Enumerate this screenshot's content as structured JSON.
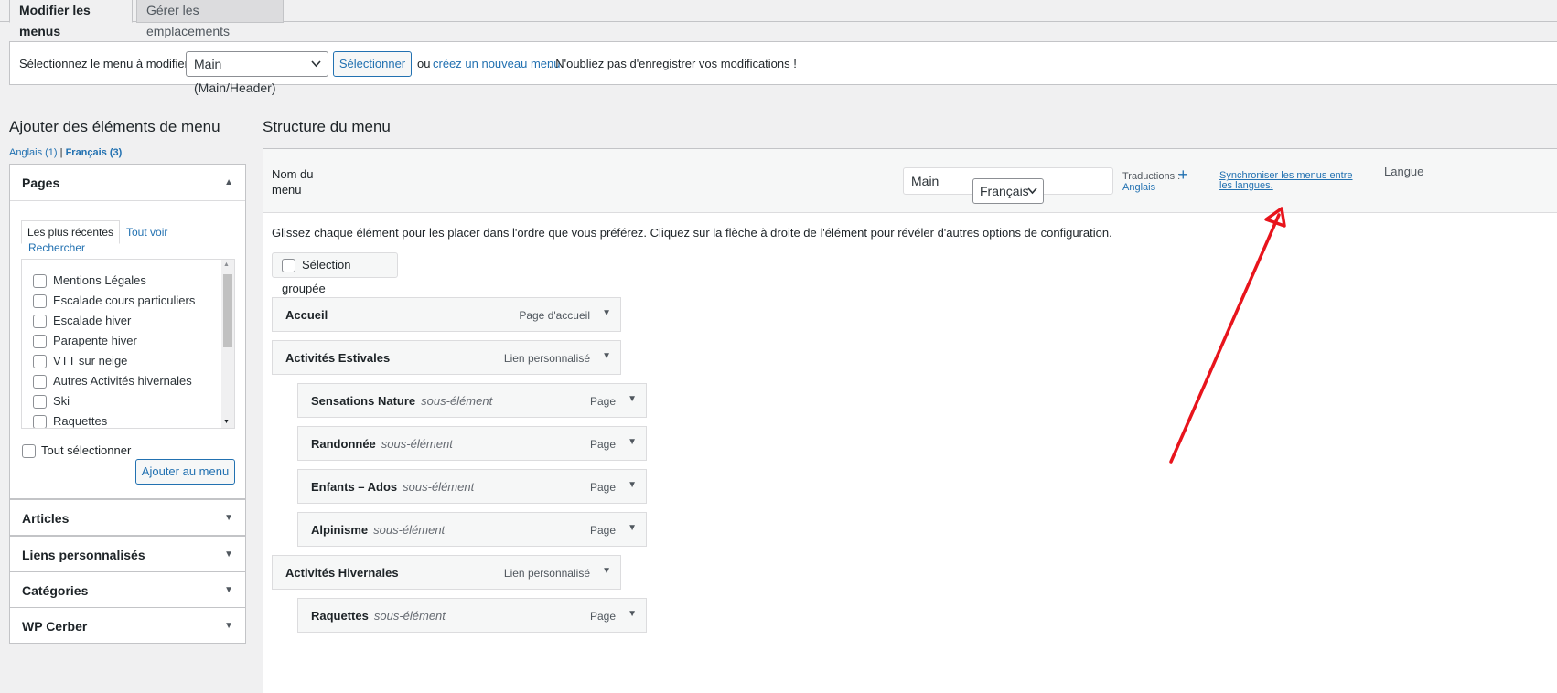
{
  "tabs": {
    "edit_menus": "Modifier les menus",
    "manage_locations": "Gérer les emplacements"
  },
  "select_bar": {
    "label": "Sélectionnez le menu à modifier :",
    "menu_value": "Main (Main/Header)",
    "select_button": "Sélectionner",
    "or_text": "ou",
    "create_link": "créez un nouveau menu",
    "reminder": ". N'oubliez pas d'enregistrer vos modifications !"
  },
  "left": {
    "title": "Ajouter des éléments de menu",
    "lang_en": "Anglais (1)",
    "lang_sep": "|",
    "lang_fr": "Français (3)",
    "pages_panel": {
      "title": "Pages",
      "tabs": [
        "Les plus récentes",
        "Tout voir",
        "Rechercher"
      ],
      "items": [
        "Mentions Légales",
        "Escalade cours particuliers",
        "Escalade hiver",
        "Parapente hiver",
        "VTT sur neige",
        "Autres Activités hivernales",
        "Ski",
        "Raquettes"
      ],
      "select_all": "Tout sélectionner",
      "add_button": "Ajouter au menu"
    },
    "collapsed_panels": [
      "Articles",
      "Liens personnalisés",
      "Catégories",
      "WP Cerber"
    ]
  },
  "structure": {
    "title": "Structure du menu",
    "menu_name_label_1": "Nom du",
    "menu_name_label_2": "menu",
    "menu_name_value": "Main",
    "language_value": "Français",
    "translations_label": "Traductions :",
    "translations_lang": "Anglais",
    "plus_icon": "+",
    "sync_link": "Synchroniser les menus entre les langues.",
    "langue_label": "Langue",
    "instructions": "Glissez chaque élément pour les placer dans l'ordre que vous préférez. Cliquez sur la flèche à droite de l'élément pour révéler d'autres options de configuration.",
    "bulk_select": "Sélection groupée",
    "items": [
      {
        "title": "Accueil",
        "sub": "",
        "type": "Page d'accueil"
      },
      {
        "title": "Activités Estivales",
        "sub": "",
        "type": "Lien personnalisé"
      },
      {
        "title": "Sensations Nature",
        "sub": "sous-élément",
        "type": "Page"
      },
      {
        "title": "Randonnée",
        "sub": "sous-élément",
        "type": "Page"
      },
      {
        "title": "Enfants – Ados",
        "sub": "sous-élément",
        "type": "Page"
      },
      {
        "title": "Alpinisme",
        "sub": "sous-élément",
        "type": "Page"
      },
      {
        "title": "Activités Hivernales",
        "sub": "",
        "type": "Lien personnalisé"
      },
      {
        "title": "Raquettes",
        "sub": "sous-élément",
        "type": "Page"
      }
    ]
  },
  "icons": {
    "chevron_down": "⌄",
    "triangle_down": "▼",
    "triangle_up": "▲"
  },
  "colors": {
    "accent": "#2271b1",
    "annotation_arrow": "#e8141c"
  }
}
